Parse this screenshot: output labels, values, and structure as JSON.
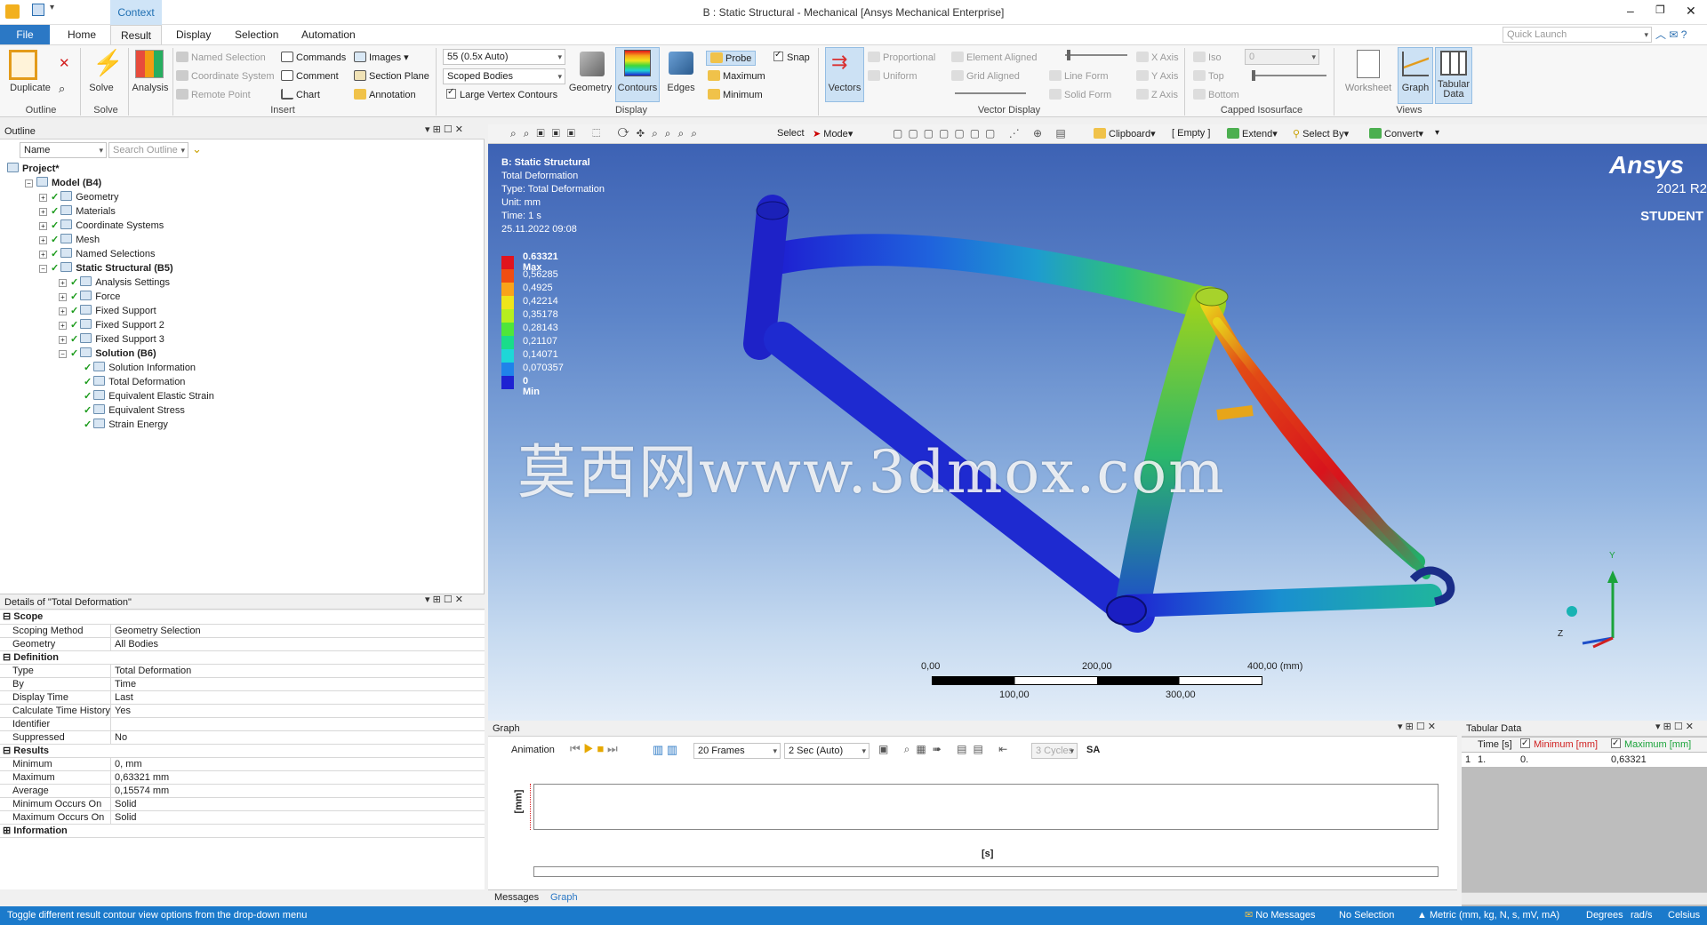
{
  "window": {
    "title": "B : Static Structural - Mechanical [Ansys Mechanical Enterprise]",
    "context_tab": "Context",
    "quick_launch_placeholder": "Quick Launch"
  },
  "tabs": [
    "File",
    "Home",
    "Result",
    "Display",
    "Selection",
    "Automation"
  ],
  "ribbon": {
    "outline_group": {
      "duplicate": "Duplicate",
      "label": "Outline"
    },
    "solve_group": {
      "solve": "Solve",
      "label": "Solve"
    },
    "analysis": "Analysis",
    "insert_group": {
      "named_selection": "Named Selection",
      "coordinate_system": "Coordinate System",
      "remote_point": "Remote Point",
      "commands": "Commands",
      "comment": "Comment",
      "chart": "Chart",
      "images": "Images",
      "section_plane": "Section Plane",
      "annotation": "Annotation",
      "label": "Insert"
    },
    "display_group": {
      "scale_value": "55 (0.5x Auto)",
      "scope_value": "Scoped Bodies",
      "large_vertex": "Large Vertex Contours",
      "geometry": "Geometry",
      "contours": "Contours",
      "edges": "Edges",
      "probe": "Probe",
      "maximum": "Maximum",
      "minimum": "Minimum",
      "snap": "Snap",
      "label": "Display"
    },
    "vector_group": {
      "vectors": "Vectors",
      "proportional": "Proportional",
      "uniform": "Uniform",
      "element_aligned": "Element Aligned",
      "grid_aligned": "Grid Aligned",
      "line_form": "Line Form",
      "solid_form": "Solid Form",
      "x_axis": "X Axis",
      "y_axis": "Y Axis",
      "z_axis": "Z Axis",
      "label": "Vector Display"
    },
    "iso_group": {
      "iso": "Iso",
      "top": "Top",
      "bottom": "Bottom",
      "value": "0",
      "label": "Capped Isosurface"
    },
    "views_group": {
      "worksheet": "Worksheet",
      "graph": "Graph",
      "tabular": "Tabular Data",
      "label": "Views"
    }
  },
  "outline": {
    "title": "Outline",
    "name_combo": "Name",
    "search_placeholder": "Search Outline",
    "tree": [
      {
        "label": "Project*",
        "bold": true,
        "level": 0
      },
      {
        "label": "Model (B4)",
        "bold": true,
        "level": 1
      },
      {
        "label": "Geometry",
        "bold": false,
        "level": 2
      },
      {
        "label": "Materials",
        "bold": false,
        "level": 2
      },
      {
        "label": "Coordinate Systems",
        "bold": false,
        "level": 2
      },
      {
        "label": "Mesh",
        "bold": false,
        "level": 2
      },
      {
        "label": "Named Selections",
        "bold": false,
        "level": 2
      },
      {
        "label": "Static Structural (B5)",
        "bold": true,
        "level": 2
      },
      {
        "label": "Analysis Settings",
        "bold": false,
        "level": 3
      },
      {
        "label": "Force",
        "bold": false,
        "level": 3
      },
      {
        "label": "Fixed Support",
        "bold": false,
        "level": 3
      },
      {
        "label": "Fixed Support 2",
        "bold": false,
        "level": 3
      },
      {
        "label": "Fixed Support 3",
        "bold": false,
        "level": 3
      },
      {
        "label": "Solution (B6)",
        "bold": true,
        "level": 3
      },
      {
        "label": "Solution Information",
        "bold": false,
        "level": 4
      },
      {
        "label": "Total Deformation",
        "bold": false,
        "level": 4
      },
      {
        "label": "Equivalent Elastic Strain",
        "bold": false,
        "level": 4
      },
      {
        "label": "Equivalent Stress",
        "bold": false,
        "level": 4
      },
      {
        "label": "Strain Energy",
        "bold": false,
        "level": 4
      }
    ]
  },
  "details": {
    "title": "Details of \"Total Deformation\"",
    "sections": [
      {
        "name": "Scope",
        "rows": [
          [
            "Scoping Method",
            "Geometry Selection"
          ],
          [
            "Geometry",
            "All Bodies"
          ]
        ]
      },
      {
        "name": "Definition",
        "rows": [
          [
            "Type",
            "Total Deformation"
          ],
          [
            "By",
            "Time"
          ],
          [
            "Display Time",
            "Last"
          ],
          [
            "Calculate Time History",
            "Yes"
          ],
          [
            "Identifier",
            ""
          ],
          [
            "Suppressed",
            "No"
          ]
        ]
      },
      {
        "name": "Results",
        "rows": [
          [
            "Minimum",
            "0, mm"
          ],
          [
            "Maximum",
            "0,63321 mm"
          ],
          [
            "Average",
            "0,15574 mm"
          ],
          [
            "Minimum Occurs On",
            "Solid"
          ],
          [
            "Maximum Occurs On",
            "Solid"
          ]
        ]
      },
      {
        "name": "Information",
        "rows": []
      }
    ]
  },
  "viewport_toolbar": {
    "select": "Select",
    "mode": "Mode",
    "clipboard": "Clipboard",
    "empty": "[ Empty ]",
    "extend": "Extend",
    "select_by": "Select By",
    "convert": "Convert"
  },
  "viewport": {
    "info": [
      "B: Static Structural",
      "Total Deformation",
      "Type: Total Deformation",
      "Unit: mm",
      "Time: 1 s",
      "25.11.2022 09:08"
    ],
    "legend": [
      {
        "label": "0.63321 Max",
        "color": "#e1141e"
      },
      {
        "label": "0,56285",
        "color": "#ef4d12"
      },
      {
        "label": "0,4925",
        "color": "#f9a31a"
      },
      {
        "label": "0,42214",
        "color": "#eee51a"
      },
      {
        "label": "0,35178",
        "color": "#b6ef1f"
      },
      {
        "label": "0,28143",
        "color": "#4fe63a"
      },
      {
        "label": "0,21107",
        "color": "#19dc8a"
      },
      {
        "label": "0,14071",
        "color": "#1ed7d7"
      },
      {
        "label": "0,070357",
        "color": "#1f83ea"
      },
      {
        "label": "0 Min",
        "color": "#1e22d2"
      }
    ],
    "brand": "Ansys",
    "version": "2021 R2",
    "edition": "STUDENT",
    "watermark": "莫西网www.3dmox.com",
    "scale_top": [
      "0,00",
      "200,00",
      "400,00 (mm)"
    ],
    "scale_bottom": [
      "100,00",
      "300,00"
    ],
    "triad": {
      "y": "Y",
      "z": "Z"
    }
  },
  "graph": {
    "title": "Graph",
    "animation": "Animation",
    "frames": "20 Frames",
    "speed": "2 Sec (Auto)",
    "cycles": "3 Cycles",
    "sa": "SA",
    "ylabel": "[mm]",
    "xlabel": "[s]"
  },
  "tabular": {
    "title": "Tabular Data",
    "headers": [
      "Time [s]",
      "Minimum [mm]",
      "Maximum [mm]"
    ],
    "row": [
      "1",
      "1.",
      "0.",
      "0,63321"
    ]
  },
  "bottom_tabs": [
    "Messages",
    "Graph"
  ],
  "status": {
    "hint": "Toggle different result contour view options from the drop-down menu",
    "messages": "No Messages",
    "selection": "No Selection",
    "units": "Metric (mm, kg, N, s, mV, mA)",
    "degrees": "Degrees",
    "rads": "rad/s",
    "temp": "Celsius"
  }
}
